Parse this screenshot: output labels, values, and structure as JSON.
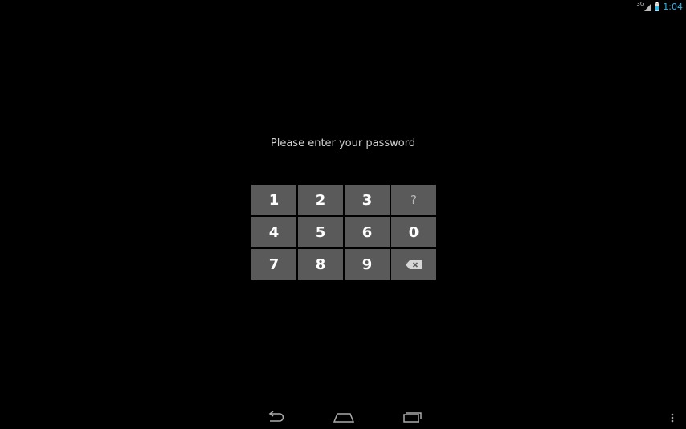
{
  "status_bar": {
    "network_label": "3G",
    "clock": "1:04",
    "signal_icon": "signal-icon",
    "battery_icon": "battery-icon",
    "clock_color": "#33b5e5"
  },
  "prompt": "Please enter your password",
  "keypad": {
    "keys": [
      {
        "label": "1",
        "name": "key-1"
      },
      {
        "label": "2",
        "name": "key-2"
      },
      {
        "label": "3",
        "name": "key-3"
      },
      {
        "label": "?",
        "name": "key-help"
      },
      {
        "label": "4",
        "name": "key-4"
      },
      {
        "label": "5",
        "name": "key-5"
      },
      {
        "label": "6",
        "name": "key-6"
      },
      {
        "label": "0",
        "name": "key-0"
      },
      {
        "label": "7",
        "name": "key-7"
      },
      {
        "label": "8",
        "name": "key-8"
      },
      {
        "label": "9",
        "name": "key-9"
      },
      {
        "label": "",
        "name": "key-backspace",
        "icon": "backspace-icon"
      }
    ],
    "key_color": "#5a5a5a"
  },
  "nav_bar": {
    "back_icon": "back-icon",
    "home_icon": "home-icon",
    "recents_icon": "recents-icon",
    "menu_icon": "overflow-menu-icon"
  }
}
